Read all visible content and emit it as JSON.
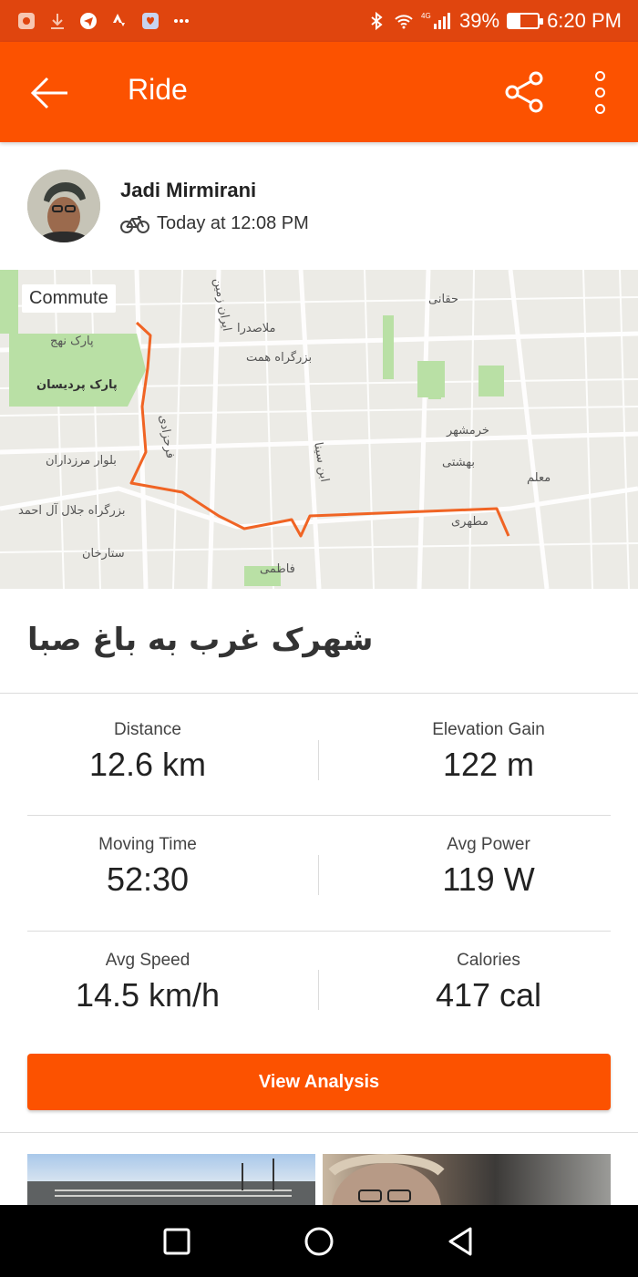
{
  "status_bar": {
    "battery": "39%",
    "battery_level": 0.39,
    "network": "4G",
    "time": "6:20 PM",
    "left_icons": [
      "app-icon",
      "download-icon",
      "telegram-icon",
      "strava-icon",
      "app-icon-2",
      "more-notifications-icon"
    ]
  },
  "app_bar": {
    "title": "Ride",
    "color": "#fc5200"
  },
  "athlete": {
    "name": "Jadi Mirmirani",
    "activity_time": "Today at 12:08 PM",
    "activity_type_icon": "bike-icon"
  },
  "map": {
    "tag": "Commute",
    "labels": [
      "پارک نهج",
      "پارک پردیسان",
      "بلوار مرزداران",
      "بزرگراه جلال آل احمد",
      "ملاصدرا",
      "بزرگراه همت",
      "حقانی",
      "خرمشهر",
      "بهشتی",
      "معلم",
      "مطهری",
      "فاطمی",
      "ستارخان",
      "فرحزادی",
      "ایران زمین",
      "ابن سینا"
    ],
    "route_color": "#f06424"
  },
  "activity": {
    "title": "شهرک غرب به باغ صبا"
  },
  "stats": [
    {
      "label": "Distance",
      "value": "12.6 km"
    },
    {
      "label": "Elevation Gain",
      "value": "122 m"
    },
    {
      "label": "Moving Time",
      "value": "52:30"
    },
    {
      "label": "Avg Power",
      "value": "119 W"
    },
    {
      "label": "Avg Speed",
      "value": "14.5 km/h"
    },
    {
      "label": "Calories",
      "value": "417 cal"
    }
  ],
  "actions": {
    "view_analysis": "View Analysis"
  }
}
